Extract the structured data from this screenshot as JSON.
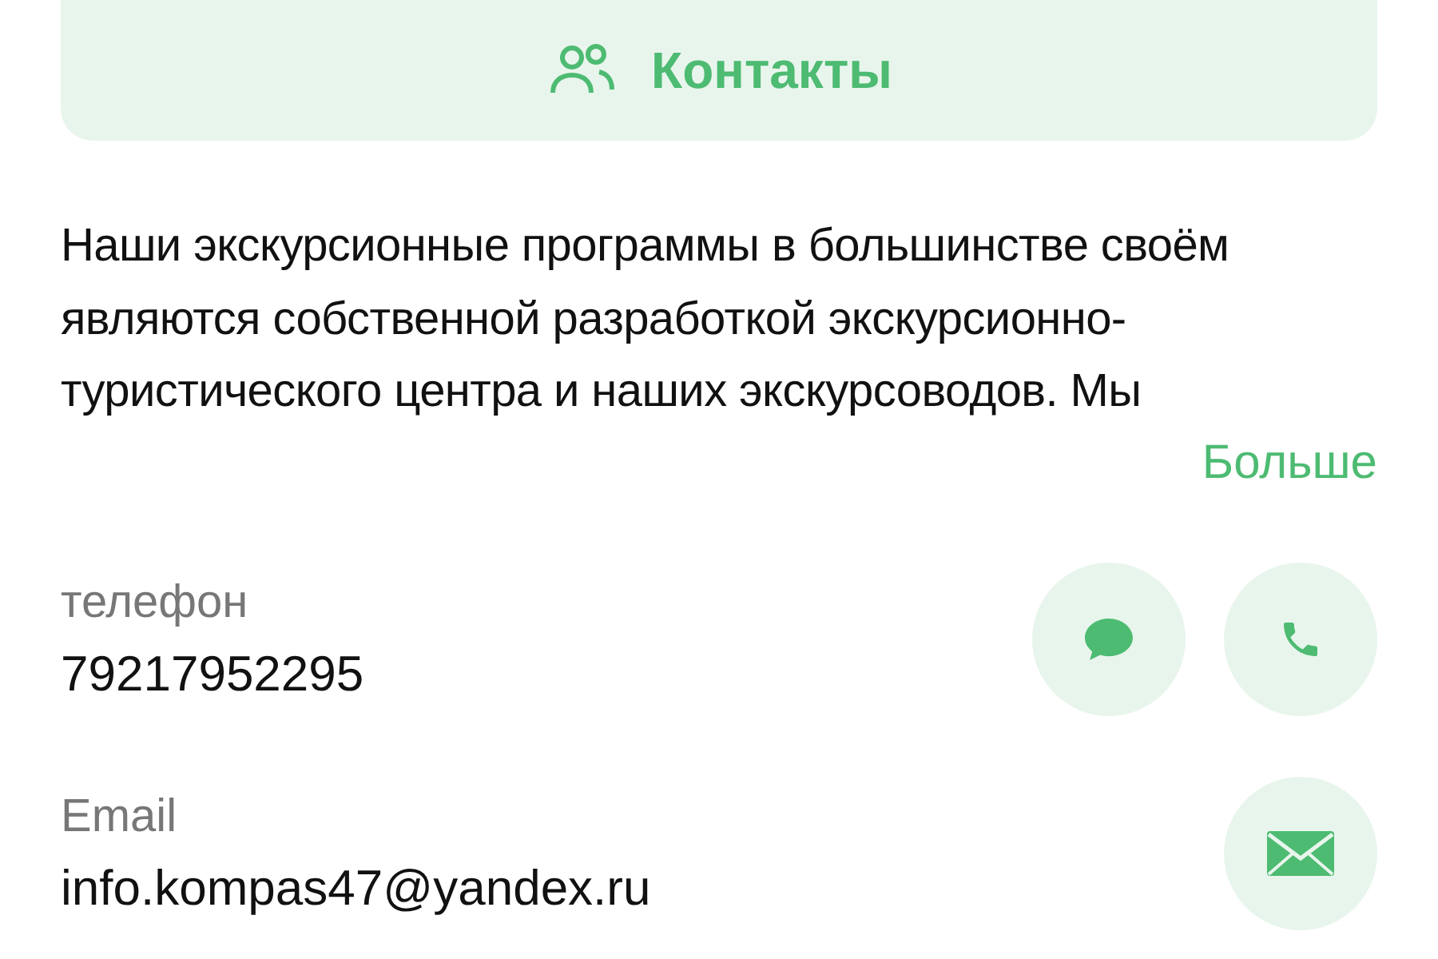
{
  "contacts_button": {
    "label": "Контакты"
  },
  "description": {
    "text": "Наши экскурсионные программы в большинстве своём являются собственной разработкой экскурсионно-туристического центра и наших экскурсоводов. Мы",
    "more": "Больше"
  },
  "contacts": [
    {
      "kind": "phone",
      "label": "телефон",
      "value": "79217952295"
    },
    {
      "kind": "email",
      "label": "Email",
      "value": "info.kompas47@yandex.ru"
    }
  ]
}
